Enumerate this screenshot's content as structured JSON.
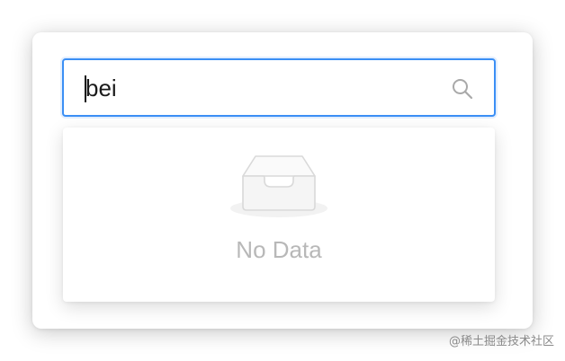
{
  "search": {
    "value": "bei",
    "focused_border_color": "#3b8ff5",
    "icon": "search-icon"
  },
  "dropdown": {
    "empty_icon": "empty-inbox-icon",
    "empty_text": "No Data"
  },
  "watermark": {
    "text": "@稀土掘金技术社区"
  }
}
